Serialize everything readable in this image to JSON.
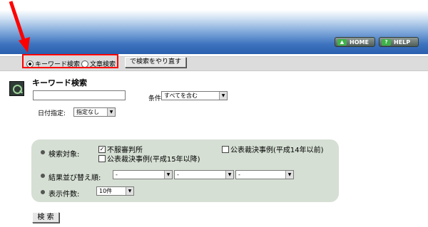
{
  "header": {
    "home_button": "HOME",
    "help_button": "HELP",
    "home_icon": "home-arrow-icon",
    "help_icon": "question-icon"
  },
  "toolbar": {
    "radio_keyword": "キーワード検索",
    "radio_text": "文章検索",
    "redo_button": "で検索をやり直す",
    "selected": "keyword"
  },
  "form": {
    "title": "キーワード検索",
    "condition_label": "条件:",
    "condition_value": "すべてを含む",
    "date_label": "日付指定:",
    "date_value": "指定なし"
  },
  "options": {
    "target_label": "検索対象:",
    "target_1": "不服審判所",
    "target_2": "公表裁決事例(平成14年以前)",
    "target_3": "公表裁決事例(平成15年以降)",
    "sort_label": "結果並び替え順:",
    "sort_1": "-",
    "sort_2": "-",
    "sort_3": "-",
    "count_label": "表示件数:",
    "count_value": "10件"
  },
  "search_button": "検 索",
  "colors": {
    "highlight": "#ff0000",
    "panel": "#d5dfd3"
  }
}
